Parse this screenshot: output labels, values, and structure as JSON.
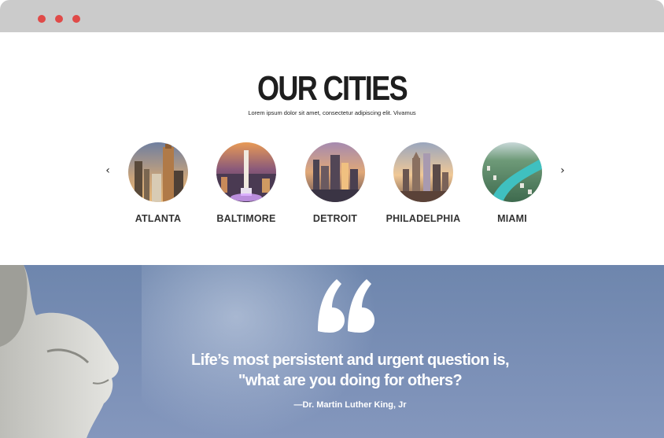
{
  "window": {
    "controls": [
      "close",
      "minimize",
      "maximize"
    ],
    "control_color": "#e04a48"
  },
  "cities_section": {
    "title": "OUR CITIES",
    "subtitle": "Lorem ipsum dolor sit amet, consectetur adipiscing elit. Vivamus",
    "prev_icon": "‹",
    "next_icon": "›",
    "cities": [
      {
        "name": "ATLANTA"
      },
      {
        "name": "BALTIMORE"
      },
      {
        "name": "DETROIT"
      },
      {
        "name": "PHILADELPHIA"
      },
      {
        "name": "MIAMI"
      }
    ]
  },
  "quote_section": {
    "line1": "Life’s most persistent and urgent question is,",
    "line2": "\"what are you doing for others?",
    "author": "—Dr. Martin Luther King, Jr",
    "background_color": "#7a8fb6"
  }
}
